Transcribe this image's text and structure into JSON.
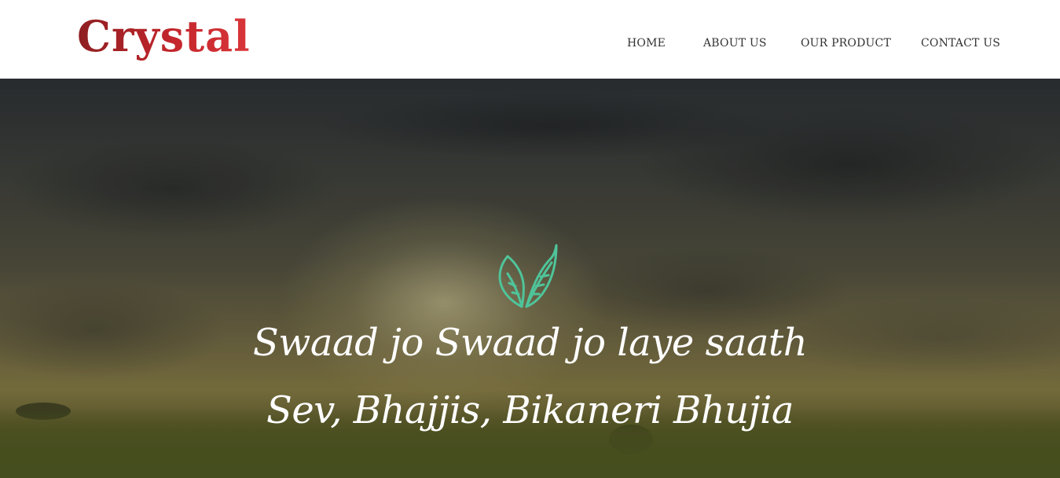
{
  "header": {
    "logo_text": "Crystal",
    "nav": {
      "home": "HOME",
      "about": "ABOUT US",
      "product": "OUR PRODUCT",
      "contact": "CONTACT US"
    }
  },
  "hero": {
    "icon": "leaf-icon",
    "line1": "Swaad jo Swaad jo laye saath",
    "line2": "Sev,  Bhajjis,  Bikaneri Bhujia"
  },
  "colors": {
    "logo": "#b8262b",
    "leaf_icon": "#4fc49a",
    "nav_text": "#333333",
    "tagline": "#ffffff"
  }
}
